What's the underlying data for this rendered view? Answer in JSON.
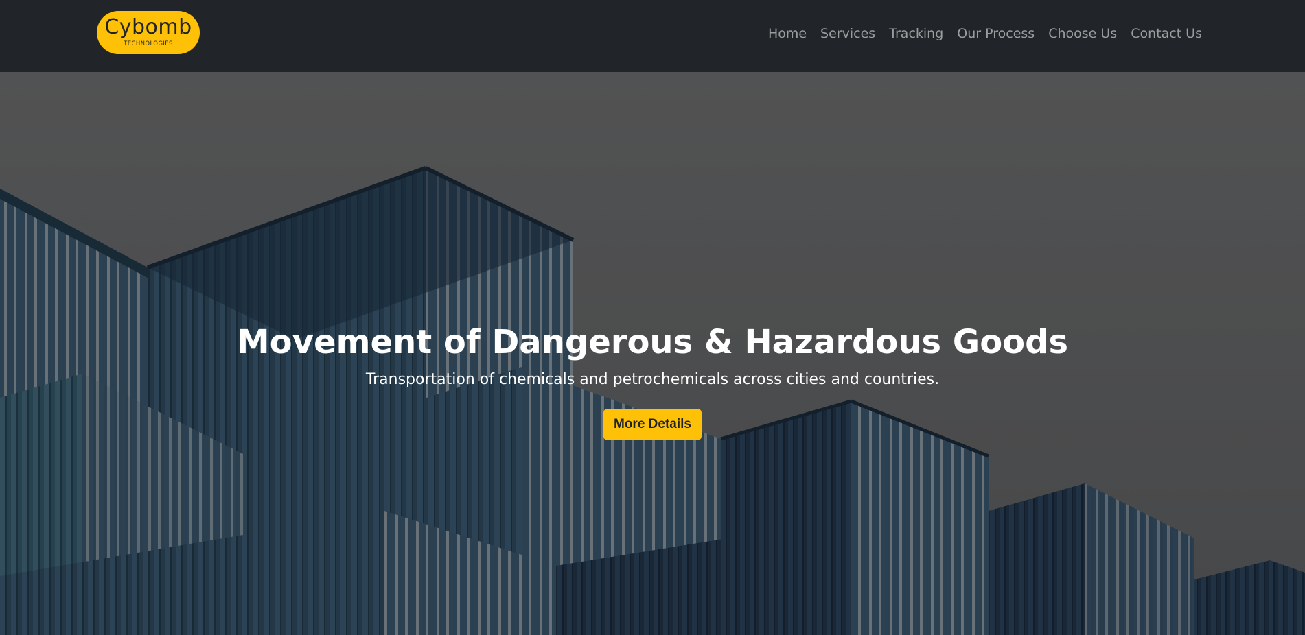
{
  "brand": {
    "name": "Cybomb",
    "tagline": "TECHNOLOGIES",
    "accent_color": "#ffc107"
  },
  "nav": {
    "items": [
      {
        "label": "Home"
      },
      {
        "label": "Services"
      },
      {
        "label": "Tracking"
      },
      {
        "label": "Our Process"
      },
      {
        "label": "Choose Us"
      },
      {
        "label": "Contact Us"
      }
    ]
  },
  "hero": {
    "title": "Movement of Dangerous & Hazardous Goods",
    "subtitle": "Transportation of chemicals and petrochemicals across cities and countries.",
    "cta_label": "More Details",
    "background": "stacked shipping containers"
  }
}
